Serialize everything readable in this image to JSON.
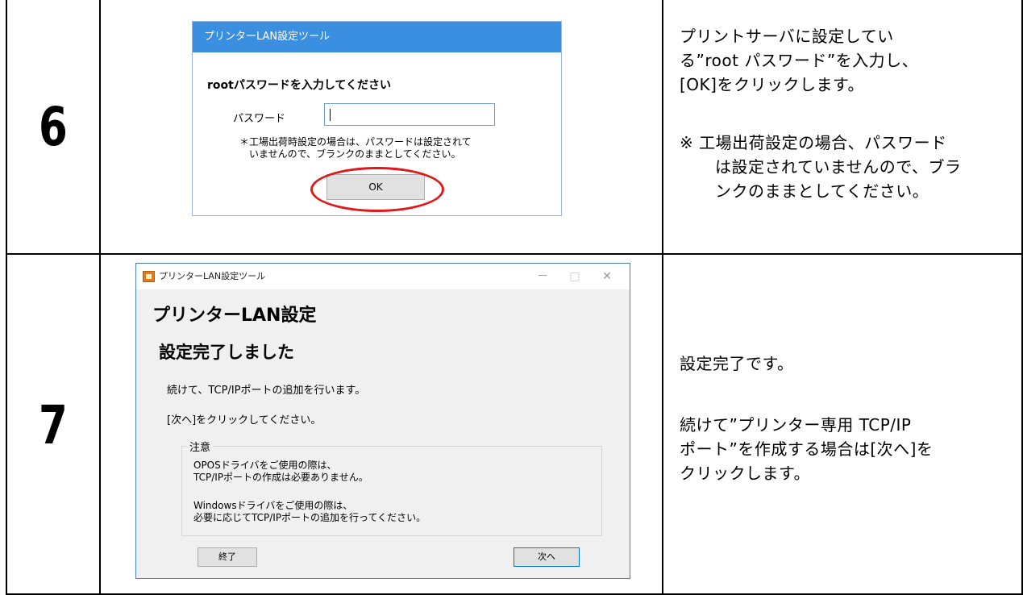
{
  "steps": [
    {
      "number": "6",
      "dialog": {
        "title": "プリンターLAN設定ツール",
        "heading": "rootパスワードを入力してください",
        "password_label": "パスワード",
        "password_value": "",
        "note_line1": "＊工場出荷時設定の場合は、パスワードは設定されて",
        "note_line2": "いませんので、ブランクのままとしてください。",
        "ok_button": "OK"
      },
      "description": {
        "line1": "プリントサーバに設定してい",
        "line2": "る”root パスワード”を入力し、",
        "line3": "[OK]をクリックします。",
        "note1": "※ 工場出荷設定の場合、パスワード",
        "note2": "は設定されていませんので、ブラ",
        "note3": "ンクのままとしてください。"
      }
    },
    {
      "number": "7",
      "dialog": {
        "title": "プリンターLAN設定ツール",
        "window_min": "－",
        "window_max": "□",
        "window_close": "✕",
        "big_title": "プリンターLAN設定",
        "sub_title": "設定完了しました",
        "line1": "続けて、TCP/IPポートの追加を行います。",
        "line2": "[次へ]をクリックしてください。",
        "caution_label": "注意",
        "caution_line1": "OPOSドライバをご使用の際は、",
        "caution_line2": "TCP/IPポートの作成は必要ありません。",
        "caution_line3": "Windowsドライバをご使用の際は、",
        "caution_line4": "必要に応じてTCP/IPポートの追加を行ってください。",
        "end_button": "終了",
        "next_button": "次へ"
      },
      "description": {
        "line1": "設定完了です。",
        "line2": "続けて”プリンター専用 TCP/IP",
        "line3": "ポート”を作成する場合は[次へ]を",
        "line4": "クリックします。"
      }
    }
  ],
  "colors": {
    "titlebar_blue": "#3b8fe0",
    "highlight_ring": "#e01818",
    "app_icon": "#e07b22"
  }
}
